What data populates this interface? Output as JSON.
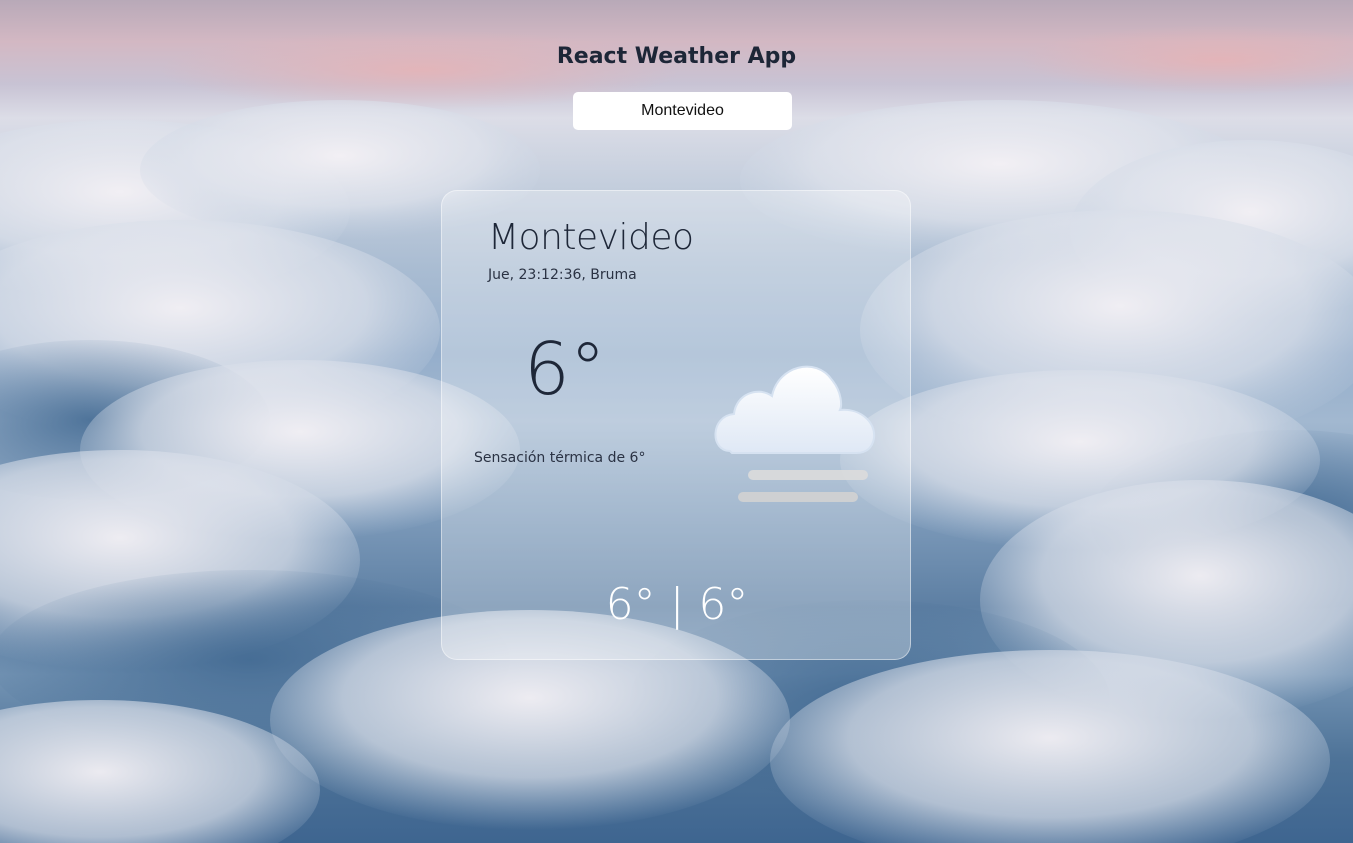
{
  "app": {
    "title": "React Weather App"
  },
  "search": {
    "value": "Montevideo"
  },
  "weather": {
    "city": "Montevideo",
    "meta": "Jue, 23:12:36, Bruma",
    "temp": "6°",
    "feels_like": "Sensación térmica de 6°",
    "min": "6°",
    "max": "6°",
    "separator": "|",
    "icon": "fog-cloud-icon"
  },
  "background": {
    "theme": "clouds"
  }
}
